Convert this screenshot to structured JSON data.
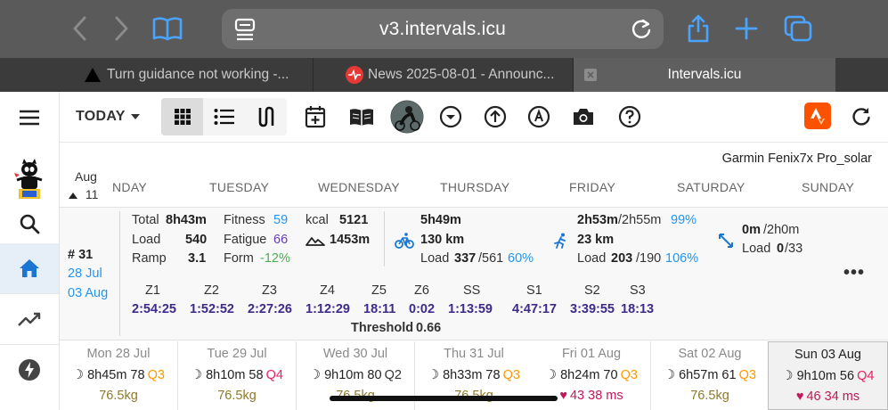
{
  "browser": {
    "url": "v3.intervals.icu",
    "tabs": [
      {
        "title": "Turn guidance not working -..."
      },
      {
        "title": "News 2025-08-01 - Announc..."
      },
      {
        "title": "Intervals.icu"
      }
    ]
  },
  "toolbar": {
    "today_label": "TODAY"
  },
  "header": {
    "device": "Garmin Fenix7x Pro_solar",
    "month": "Aug",
    "week_num": "11",
    "day_names": [
      "NDAY",
      "TUESDAY",
      "WEDNESDAY",
      "THURSDAY",
      "FRIDAY",
      "SATURDAY",
      "SUNDAY"
    ]
  },
  "summary": {
    "week_no": "# 31",
    "date_from": "28 Jul",
    "date_to": "03 Aug",
    "total_label": "Total",
    "total_value": "8h43m",
    "load_label": "Load",
    "load_value": "540",
    "ramp_label": "Ramp",
    "ramp_value": "3.1",
    "fitness_label": "Fitness",
    "fitness_value": "59",
    "fatigue_label": "Fatigue",
    "fatigue_value": "66",
    "form_label": "Form",
    "form_value": "-12%",
    "kcal_label": "kcal",
    "kcal_value": "5121",
    "elev_value": "1453m",
    "ride_time": "5h49m",
    "ride_dist": "130 km",
    "ride_load_label": "Load",
    "ride_load": "337",
    "ride_load_target": "/561",
    "ride_load_pct": "60%",
    "run_time": "2h53m",
    "run_time_target": "/2h55m",
    "run_time_pct": "99%",
    "run_dist": "23 km",
    "run_load_label": "Load",
    "run_load": "203",
    "run_load_target": "/190",
    "run_load_pct": "106%",
    "other_time": "0m",
    "other_time_target": "/2h0m",
    "other_load_label": "Load",
    "other_load": "0",
    "other_load_target": "/33",
    "zones": [
      {
        "name": "Z1",
        "value": "2:54:25"
      },
      {
        "name": "Z2",
        "value": "1:52:52"
      },
      {
        "name": "Z3",
        "value": "2:27:26"
      },
      {
        "name": "Z4",
        "value": "1:12:29"
      },
      {
        "name": "Z5",
        "value": "18:11"
      },
      {
        "name": "Z6",
        "value": "0:02"
      },
      {
        "name": "SS",
        "value": "1:13:59"
      },
      {
        "name": "S1",
        "value": "4:47:17"
      },
      {
        "name": "S2",
        "value": "3:39:55"
      },
      {
        "name": "S3",
        "value": "18:13"
      }
    ],
    "threshold_label": "Threshold",
    "threshold_value": "0.66"
  },
  "days": [
    {
      "date": "Mon 28 Jul",
      "sleep": "8h45m",
      "score": "78",
      "quality": "Q3",
      "extra": "76.5kg"
    },
    {
      "date": "Tue 29 Jul",
      "sleep": "8h10m",
      "score": "58",
      "quality": "Q4",
      "extra": "76.5kg"
    },
    {
      "date": "Wed 30 Jul",
      "sleep": "9h10m",
      "score": "80",
      "quality": "Q2",
      "extra": "76.5kg"
    },
    {
      "date": "Thu 31 Jul",
      "sleep": "8h33m",
      "score": "78",
      "quality": "Q3",
      "extra": "76.5kg"
    },
    {
      "date": "Fri 01 Aug",
      "sleep": "8h24m",
      "score": "70",
      "quality": "Q3",
      "extra": "43 38 ms"
    },
    {
      "date": "Sat 02 Aug",
      "sleep": "6h57m",
      "score": "61",
      "quality": "Q3",
      "extra": "76.5kg"
    },
    {
      "date": "Sun 03 Aug",
      "sleep": "9h10m",
      "score": "56",
      "quality": "Q4",
      "extra": "46 34 ms"
    }
  ],
  "colors": {
    "accent": "#2196f3",
    "strava": "#fc5200",
    "fatigue": "#673ab7",
    "form": "#4caf50"
  }
}
